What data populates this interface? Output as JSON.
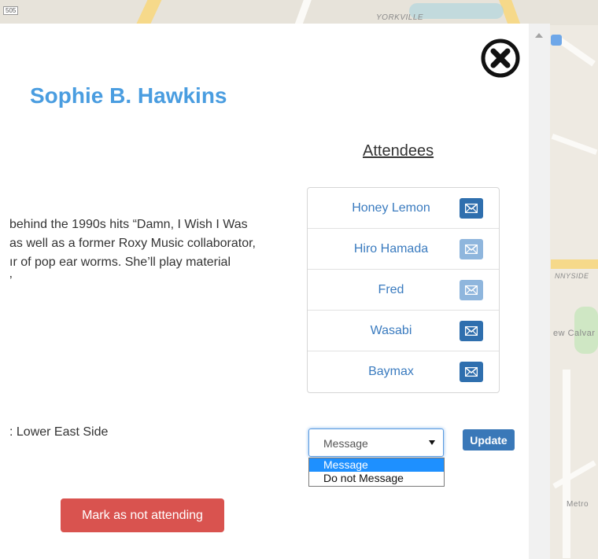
{
  "map": {
    "labels": [
      "505",
      "YORKVILLE",
      "NNYSIDE",
      "ew Calvar",
      "Metro"
    ],
    "colors": {
      "background": "#eeeae2",
      "road_major": "#f6d98a",
      "water": "#aad3df"
    }
  },
  "modal": {
    "title": "Sophie B. Hawkins",
    "close_icon": "close-circle-icon",
    "description_lines": [
      "behind the 1990s hits  “Damn, I Wish I Was",
      " as well as a former Roxy Music collaborator,",
      "ır of pop ear worms. She’ll play material",
      "’"
    ],
    "attendees_heading": "Attendees",
    "attendees": [
      {
        "name": "Honey Lemon",
        "icon": "envelope-icon",
        "message_enabled": true
      },
      {
        "name": "Hiro Hamada",
        "icon": "envelope-icon",
        "message_enabled": false
      },
      {
        "name": "Fred",
        "icon": "envelope-icon",
        "message_enabled": false
      },
      {
        "name": "Wasabi",
        "icon": "envelope-icon",
        "message_enabled": true
      },
      {
        "name": "Baymax",
        "icon": "envelope-icon",
        "message_enabled": true
      }
    ],
    "location_text": ": Lower East Side",
    "message_select": {
      "selected": "Message",
      "options": [
        "Message",
        "Do not Message"
      ]
    },
    "update_label": "Update",
    "not_attending_label": "Mark as not attending",
    "colors": {
      "title": "#4a9de0",
      "link": "#3a7bbf",
      "mail_enabled": "#2f6fae",
      "mail_disabled": "#8fb6dd",
      "update": "#3a78b8",
      "danger": "#d9534f"
    }
  }
}
